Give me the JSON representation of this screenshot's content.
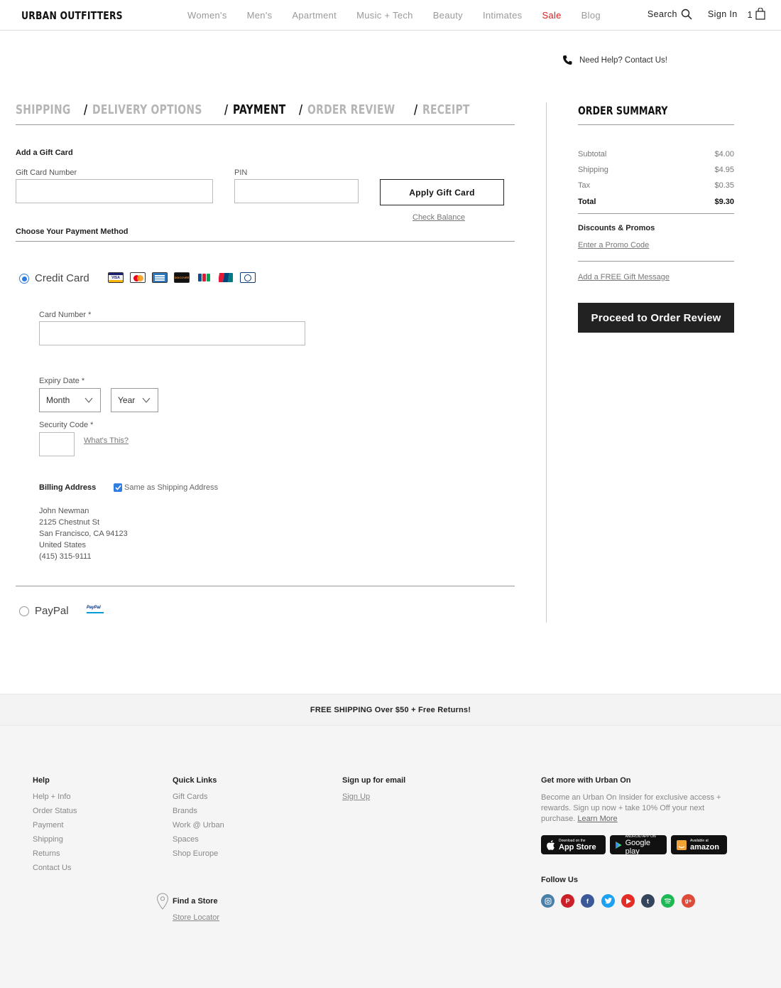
{
  "header": {
    "logo": "URBAN OUTFITTERS",
    "nav": [
      "Women's",
      "Men's",
      "Apartment",
      "Music + Tech",
      "Beauty",
      "Intimates",
      "Sale",
      "Blog"
    ],
    "search_label": "Search",
    "signin_label": "Sign In",
    "cart_count": "1"
  },
  "help": {
    "text": "Need Help? Contact Us!"
  },
  "steps": [
    {
      "label": "SHIPPING",
      "active": false
    },
    {
      "label": "DELIVERY OPTIONS",
      "active": false
    },
    {
      "label": "PAYMENT",
      "active": true
    },
    {
      "label": "ORDER REVIEW",
      "active": false
    },
    {
      "label": "RECEIPT",
      "active": false
    }
  ],
  "step_separator": "/",
  "gift_card": {
    "title": "Add a Gift Card",
    "number_label": "Gift Card Number",
    "pin_label": "PIN",
    "apply_label": "Apply Gift Card",
    "check_balance": "Check Balance"
  },
  "payment": {
    "title": "Choose Your Payment Method",
    "credit_card_label": "Credit Card",
    "card_brands": [
      "visa",
      "mastercard",
      "amex",
      "discover",
      "jcb",
      "unionpay",
      "diners"
    ],
    "card_number_label": "Card Number *",
    "expiry_label": "Expiry Date *",
    "month_placeholder": "Month",
    "year_placeholder": "Year",
    "security_label": "Security Code *",
    "whats_this": "What's This?",
    "billing_title": "Billing Address",
    "same_as_shipping": "Same as Shipping Address",
    "address": [
      "John Newman",
      "2125 Chestnut St",
      "San Francisco, CA 94123",
      "United States",
      "(415) 315-9111"
    ],
    "paypal_label": "PayPal",
    "paypal_logo": "PayPal"
  },
  "summary": {
    "title": "ORDER SUMMARY",
    "subtotal_label": "Subtotal",
    "subtotal": "$4.00",
    "shipping_label": "Shipping",
    "shipping": "$4.95",
    "tax_label": "Tax",
    "tax": "$0.35",
    "total_label": "Total",
    "total": "$9.30",
    "discounts_title": "Discounts & Promos",
    "promo_link": "Enter a Promo Code",
    "gift_message": "Add a FREE Gift Message",
    "proceed_label": "Proceed to Order Review"
  },
  "promo_bar": "FREE SHIPPING Over $50 + Free Returns!",
  "footer": {
    "help_title": "Help",
    "help_links": [
      "Help + Info",
      "Order Status",
      "Payment",
      "Shipping",
      "Returns",
      "Contact Us"
    ],
    "quick_title": "Quick Links",
    "quick_links": [
      "Gift Cards",
      "Brands",
      "Work @ Urban",
      "Spaces",
      "Shop Europe"
    ],
    "find_store_title": "Find a Store",
    "store_locator": "Store Locator",
    "email_title": "Sign up for email",
    "signup": "Sign Up",
    "urban_on_title": "Get more with Urban On",
    "urban_on_text": "Become an Urban On Insider for exclusive access + rewards. Sign up now + take 10% Off your next purchase.",
    "learn_more": "Learn More",
    "badges": [
      {
        "small": "Download on the",
        "big": "App Store"
      },
      {
        "small": "ANDROID APP ON",
        "big": "Google play"
      },
      {
        "small": "Available at",
        "big": "amazon"
      }
    ],
    "follow_title": "Follow Us",
    "social": [
      {
        "name": "instagram",
        "color": "#4a7fa8"
      },
      {
        "name": "pinterest",
        "color": "#cb2027"
      },
      {
        "name": "facebook",
        "color": "#3b5998"
      },
      {
        "name": "twitter",
        "color": "#1da1f2"
      },
      {
        "name": "youtube",
        "color": "#e52d27"
      },
      {
        "name": "tumblr",
        "color": "#35465c"
      },
      {
        "name": "spotify",
        "color": "#1db954"
      },
      {
        "name": "google-plus",
        "color": "#dd4b39"
      }
    ]
  }
}
